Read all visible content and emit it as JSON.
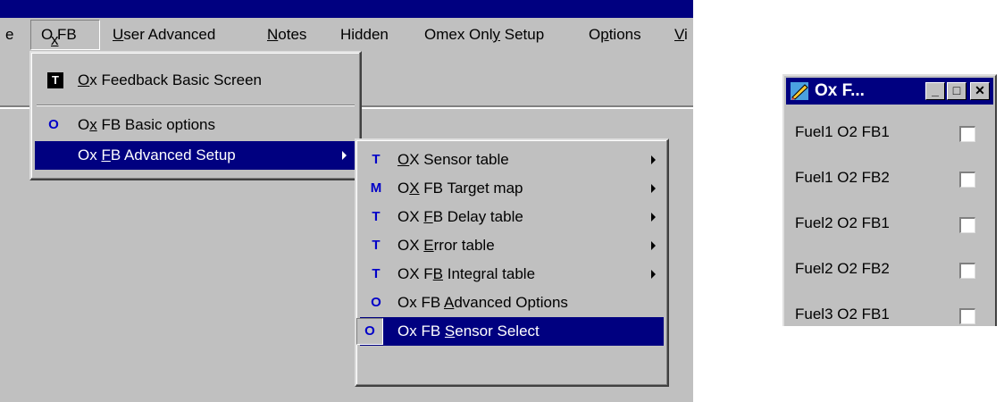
{
  "menubar": {
    "items": [
      {
        "label": "e"
      },
      {
        "label": "Ox FB"
      },
      {
        "label": "User Advanced"
      },
      {
        "label": "Notes"
      },
      {
        "label": "Hidden"
      },
      {
        "label": "Omex Only Setup"
      },
      {
        "label": "Options"
      },
      {
        "label": "Vi"
      }
    ]
  },
  "oxfb_menu": {
    "items": [
      {
        "icon": "T",
        "label": "Ox Feedback Basic Screen"
      },
      {
        "icon": "O",
        "label": "Ox FB Basic options"
      },
      {
        "label": "Ox FB Advanced Setup"
      }
    ]
  },
  "submenu": {
    "items": [
      {
        "icon": "T",
        "label": "OX Sensor table"
      },
      {
        "icon": "M",
        "label": "OX FB Target map"
      },
      {
        "icon": "T",
        "label": "OX FB Delay table"
      },
      {
        "icon": "T",
        "label": "OX Error table"
      },
      {
        "icon": "T",
        "label": "OX FB Integral table"
      },
      {
        "icon": "O",
        "label": "Ox FB Advanced Options"
      },
      {
        "icon": "O",
        "label": "Ox FB Sensor Select"
      }
    ]
  },
  "sensor_window": {
    "title": "Ox F...",
    "buttons": {
      "minimize": "_",
      "maximize": "□",
      "close": "✕"
    },
    "rows": [
      {
        "label": "Fuel1 O2 FB1",
        "checked": false
      },
      {
        "label": "Fuel1 O2 FB2",
        "checked": false
      },
      {
        "label": "Fuel2 O2 FB1",
        "checked": false
      },
      {
        "label": "Fuel2 O2 FB2",
        "checked": false
      },
      {
        "label": "Fuel3 O2 FB1",
        "checked": false
      }
    ]
  },
  "colors": {
    "selection": "#000080",
    "face": "#c0c0c0",
    "icon_blue": "#0000c8"
  }
}
